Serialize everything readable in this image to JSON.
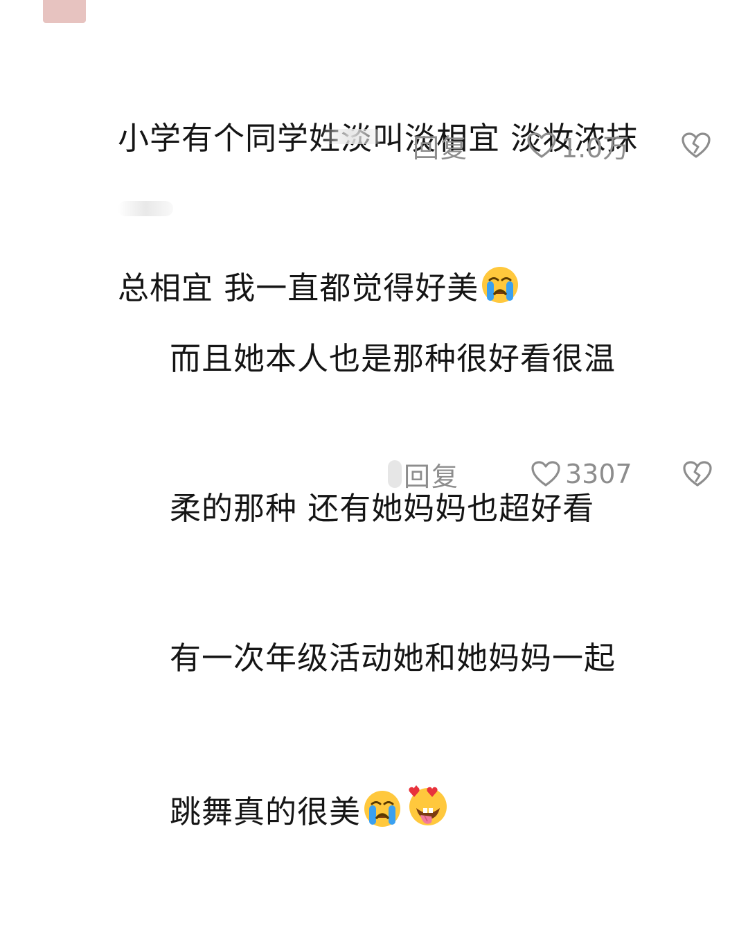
{
  "comments": [
    {
      "lines": [
        "小学有个同学姓淡叫淡相宜 淡妆浓抹",
        "总相宜  我一直都觉得好美"
      ],
      "emojis": [
        "crying-face"
      ],
      "actions": {
        "reply_label": "回复",
        "like_count": "1.0万"
      }
    },
    {
      "lines": [
        "而且她本人也是那种很好看很温",
        "柔的那种  还有她妈妈也超好看",
        "有一次年级活动她和她妈妈一起",
        "跳舞真的很美"
      ],
      "emojis": [
        "crying-face",
        "star-struck-tongue-face"
      ],
      "actions": {
        "reply_label": "回复",
        "like_count": "3307"
      }
    }
  ],
  "colors": {
    "text": "#151515",
    "meta": "#8d8d8d",
    "emoji_yellow": "#ffc83d",
    "tear_blue": "#3aa0f0"
  }
}
